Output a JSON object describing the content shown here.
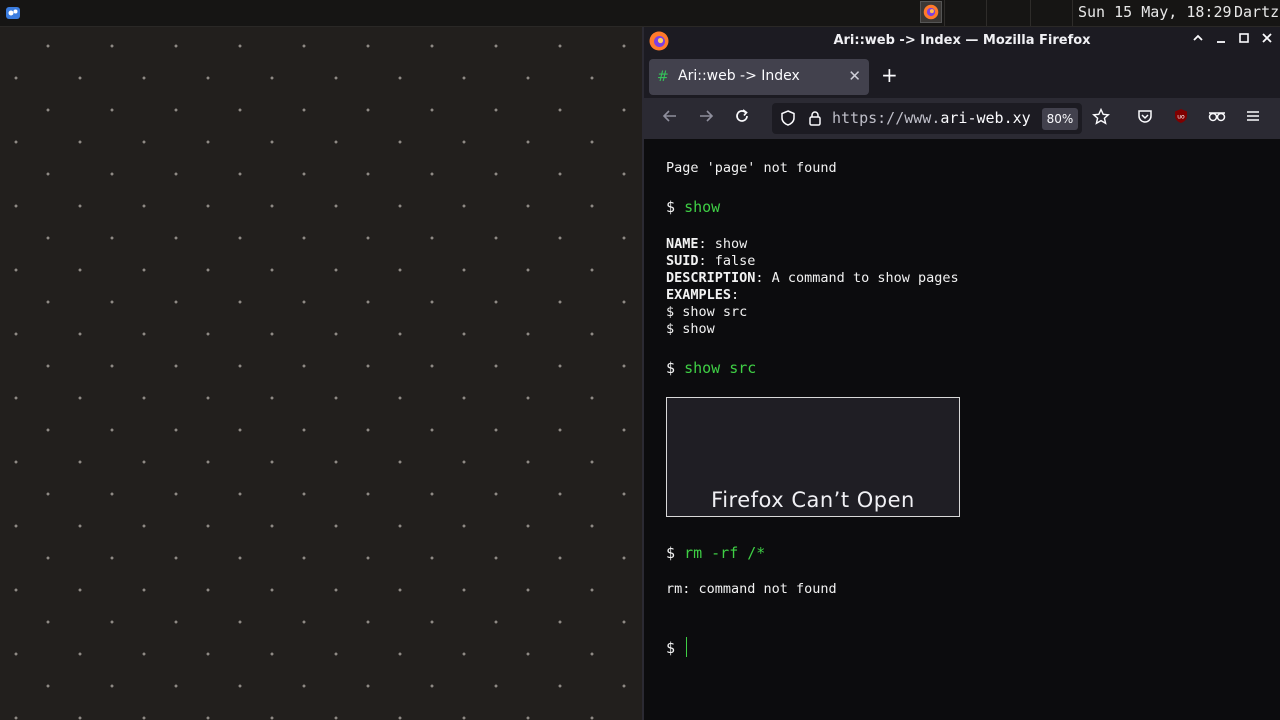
{
  "topbar": {
    "clock": "Sun 15 May, 18:29",
    "user": "Dartz"
  },
  "window": {
    "title": "Ari::web -> Index — Mozilla Firefox"
  },
  "tab": {
    "title": "Ari::web -> Index",
    "favicon": "#"
  },
  "navbar": {
    "url_prefix": "https://www.",
    "url_host": "ari-web.xyz",
    "zoom": "80%"
  },
  "terminal": {
    "line1": "Page 'page' not found",
    "prompt_symbol": "$",
    "cmd1": "show",
    "help": {
      "name_key": "NAME",
      "name_val": ": show",
      "suid_key": "SUID",
      "suid_val": ": false",
      "desc_key": "DESCRIPTION",
      "desc_val": ": A command to show pages",
      "examples_key": "EXAMPLES",
      "examples_val": ":",
      "example1": "$ show src",
      "example2": "$ show"
    },
    "cmd2": "show src",
    "frame_text": "Firefox Can’t Open",
    "cmd3": "rm -rf /*",
    "error": "rm: command not found"
  },
  "colors": {
    "command_green": "#3fcf45",
    "terminal_bg": "#0c0c0e",
    "chrome_bg": "#1c1b22"
  }
}
